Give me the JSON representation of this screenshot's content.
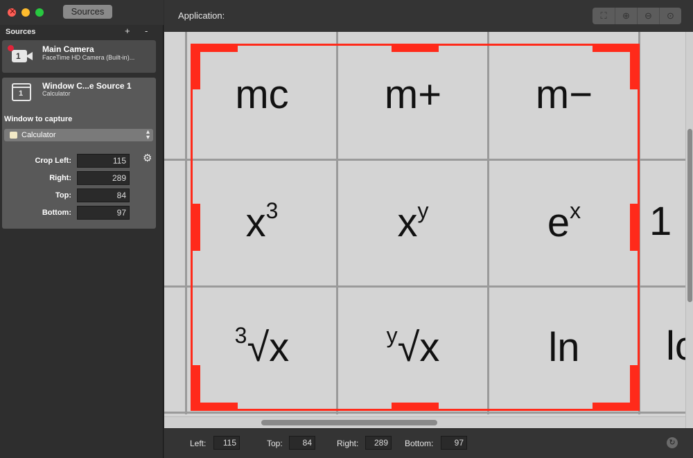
{
  "window": {
    "controls": [
      "close",
      "minimize",
      "zoom"
    ]
  },
  "sidebar": {
    "tab_label": "Sources",
    "header_label": "Sources",
    "add_label": "+",
    "remove_label": "-",
    "sources": [
      {
        "title": "Main Camera",
        "subtitle": "FaceTime HD Camera (Built-in)...",
        "icon": "camera-icon",
        "badge": "1",
        "live": true
      },
      {
        "title": "Window C...e Source 1",
        "subtitle": "Calculator",
        "icon": "window-icon",
        "badge": "1"
      }
    ],
    "window_to_capture_label": "Window to capture",
    "selected_window": "Calculator",
    "crop": {
      "left_label": "Crop Left:",
      "left_value": "115",
      "right_label": "Right:",
      "right_value": "289",
      "top_label": "Top:",
      "top_value": "84",
      "bottom_label": "Bottom:",
      "bottom_value": "97"
    }
  },
  "main": {
    "application_label": "Application:",
    "toolbar": [
      "crop-icon",
      "zoom-in-icon",
      "zoom-out-icon",
      "zoom-fit-icon"
    ],
    "preview_keys": [
      {
        "base": "mc",
        "sup": ""
      },
      {
        "base": "m+",
        "sup": ""
      },
      {
        "base": "m−",
        "sup": ""
      },
      {
        "base": "x",
        "sup": "3"
      },
      {
        "base": "x",
        "sup": "y"
      },
      {
        "base": "e",
        "sup": "x"
      },
      {
        "base": "√x",
        "sup": "3"
      },
      {
        "base": "√x",
        "sup": "y"
      },
      {
        "base": "ln",
        "sup": ""
      }
    ],
    "edge_labels": {
      "middle": "1",
      "bottom": "lc"
    },
    "bottom_bar": {
      "left_label": "Left:",
      "left_value": "115",
      "top_label": "Top:",
      "top_value": "84",
      "right_label": "Right:",
      "right_value": "289",
      "bottom_label": "Bottom:",
      "bottom_value": "97"
    }
  },
  "colors": {
    "crop_frame": "#ff2a1a",
    "live_dot": "#e0243a"
  }
}
